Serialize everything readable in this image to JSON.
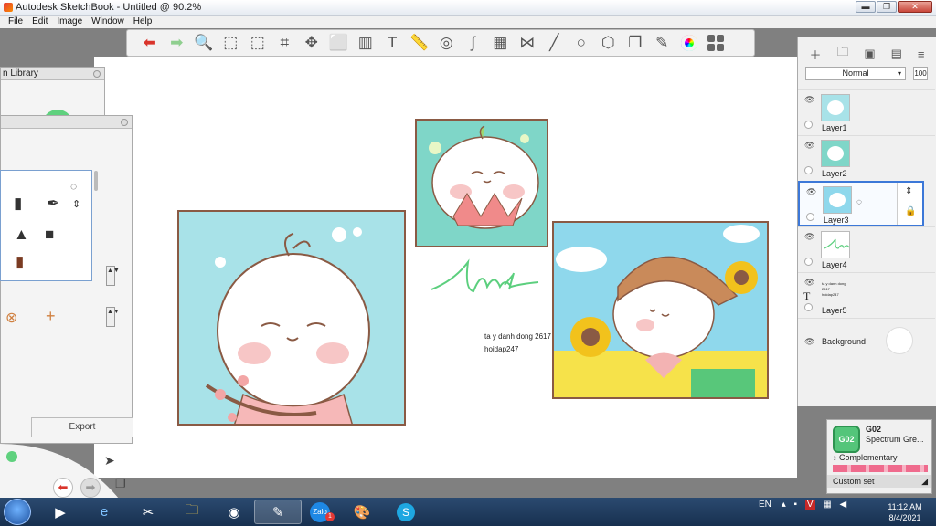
{
  "window": {
    "title": "Autodesk SketchBook - Untitled @ 90.2%",
    "buttons": {
      "minimize": "▬",
      "restore": "❐",
      "close": "✕"
    }
  },
  "menu": [
    "File",
    "Edit",
    "Image",
    "Window",
    "Help"
  ],
  "toolbar": {
    "tools": [
      {
        "name": "undo-icon",
        "glyph": "⬅"
      },
      {
        "name": "redo-icon",
        "glyph": "➡"
      },
      {
        "name": "zoom-icon",
        "glyph": "🔍"
      },
      {
        "name": "select-icon",
        "glyph": "⬚"
      },
      {
        "name": "select-crop-icon",
        "glyph": "⬚"
      },
      {
        "name": "crop-icon",
        "glyph": "⌗"
      },
      {
        "name": "transform-icon",
        "glyph": "✥"
      },
      {
        "name": "distort-icon",
        "glyph": "⬜"
      },
      {
        "name": "fill-icon",
        "glyph": "▥"
      },
      {
        "name": "text-icon",
        "glyph": "T"
      },
      {
        "name": "ruler-icon",
        "glyph": "📏"
      },
      {
        "name": "ellipse-guide-icon",
        "glyph": "◎"
      },
      {
        "name": "french-curve-icon",
        "glyph": "∫"
      },
      {
        "name": "perspective-icon",
        "glyph": "▦"
      },
      {
        "name": "symmetry-icon",
        "glyph": "⋈"
      },
      {
        "name": "line-icon",
        "glyph": "╱"
      },
      {
        "name": "circle-icon",
        "glyph": "○"
      },
      {
        "name": "shape-icon",
        "glyph": "⬡"
      },
      {
        "name": "copy-paste-icon",
        "glyph": "❐"
      },
      {
        "name": "brush-library-icon",
        "glyph": "✎"
      }
    ]
  },
  "library_panel": {
    "title": "n Library",
    "accent": "#5fd17e"
  },
  "brush_panel": {
    "export_label": "Export",
    "brushes": [
      {
        "name": "marker-icon",
        "glyph": "▮"
      },
      {
        "name": "pen-icon",
        "glyph": "✒"
      },
      {
        "name": "spray-icon",
        "glyph": "▲"
      },
      {
        "name": "block-brush-icon",
        "glyph": "■"
      },
      {
        "name": "stamp-brush-icon",
        "glyph": "▮"
      }
    ],
    "arrows": "▲▼"
  },
  "canvas": {
    "signature_text": "ta y danh dong 2617",
    "watermark_text": "hoidap247"
  },
  "layers": {
    "blend_mode": "Normal",
    "opacity": "100",
    "items": [
      {
        "label": "Layer1"
      },
      {
        "label": "Layer2"
      },
      {
        "label": "Layer3"
      },
      {
        "label": "Layer4"
      },
      {
        "label": "Layer5"
      },
      {
        "label": "Background"
      }
    ]
  },
  "color": {
    "swatch_code": "G02",
    "swatch_name": "Spectrum Gre...",
    "mode_label": "Complementary",
    "custom_label": "Custom set",
    "swatch_color": "#54c57a"
  },
  "taskbar": {
    "language": "EN",
    "time": "11:12 AM",
    "date": "8/4/2021",
    "zalo_badge": "1"
  }
}
